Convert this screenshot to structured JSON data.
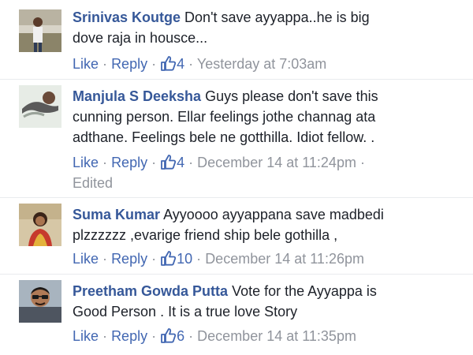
{
  "comments": [
    {
      "author": "Srinivas Koutge",
      "text_line1": "Don't save ayyappa..he is big",
      "text_line2": "dove raja in housce...",
      "like_label": "Like",
      "reply_label": "Reply",
      "separator": "·",
      "like_count": "4",
      "timestamp": "Yesterday at 7:03am"
    },
    {
      "author": "Manjula S Deeksha",
      "text_line1": "Guys please don't save this",
      "text_line2": "cunning person. Ellar feelings jothe channag ata",
      "text_line3": "adthane. Feelings bele ne gotthilla. Idiot fellow. .",
      "like_label": "Like",
      "reply_label": "Reply",
      "separator": "·",
      "like_count": "4",
      "timestamp": "December 14 at 11:24pm",
      "edited": "Edited"
    },
    {
      "author": "Suma Kumar",
      "text_line1": "Ayyoooo ayyappana save madbedi",
      "text_line2": "plzzzzzz ,evarige friend ship bele gothilla ,",
      "like_label": "Like",
      "reply_label": "Reply",
      "separator": "·",
      "like_count": "10",
      "timestamp": "December 14 at 11:26pm"
    },
    {
      "author": "Preetham Gowda Putta",
      "text_line1": "Vote for the Ayyappa is",
      "text_line2": "Good Person . It is a true love Story",
      "like_label": "Like",
      "reply_label": "Reply",
      "separator": "·",
      "like_count": "6",
      "timestamp": "December 14 at 11:35pm"
    }
  ],
  "colors": {
    "author": "#365899",
    "link": "#4267b2",
    "meta": "#90949c",
    "text": "#1d2129"
  }
}
